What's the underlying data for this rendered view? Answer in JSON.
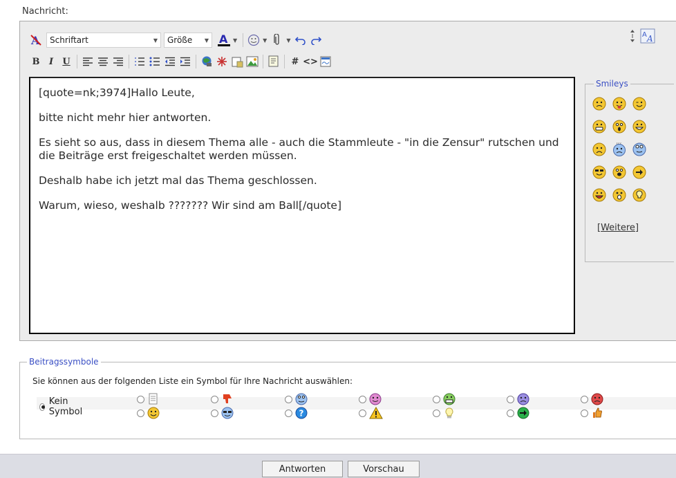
{
  "header": {
    "label": "Nachricht:"
  },
  "toolbar": {
    "font_select": "Schriftart",
    "size_select": "Größe",
    "bold_label": "B",
    "italic_label": "I",
    "underline_label": "U",
    "hash_label": "#",
    "code_label": "<>"
  },
  "message": {
    "paragraphs": [
      "[quote=nk;3974]Hallo Leute,",
      "bitte nicht mehr hier antworten.",
      "Es sieht so aus, dass in diesem Thema alle - auch die Stammleute - \"in die Zensur\" rutschen und die Beiträge erst freigeschaltet werden müssen.",
      "Deshalb habe ich jetzt mal das Thema geschlossen.",
      "Warum, wieso, weshalb ??????? Wir sind am Ball[/quote]"
    ]
  },
  "smileys": {
    "legend": "Smileys",
    "more_label": "Weitere",
    "icons": [
      "mad-smiley-icon",
      "tongue-smiley-icon",
      "wink-smiley-icon",
      "grin-smiley-icon",
      "shocked-smiley-icon",
      "big-smile-icon",
      "sad-smiley-icon",
      "confused-smiley-icon",
      "roll-eyes-smiley-icon",
      "cool-smiley-icon",
      "eek-smiley-icon",
      "arrow-right-smiley-icon",
      "happy-smiley-icon",
      "surprised-smiley-icon",
      "idea-smiley-icon"
    ]
  },
  "post_icons": {
    "legend": "Beitragssymbole",
    "intro": "Sie können aus der folgenden Liste ein Symbol für Ihre Nachricht auswählen:",
    "no_symbol_label": "Kein Symbol"
  },
  "buttons": {
    "reply": "Antworten",
    "preview": "Vorschau"
  },
  "colors": {
    "accent": "#3a4fc4",
    "frame": "#ececec",
    "footer": "#dcdde4"
  }
}
